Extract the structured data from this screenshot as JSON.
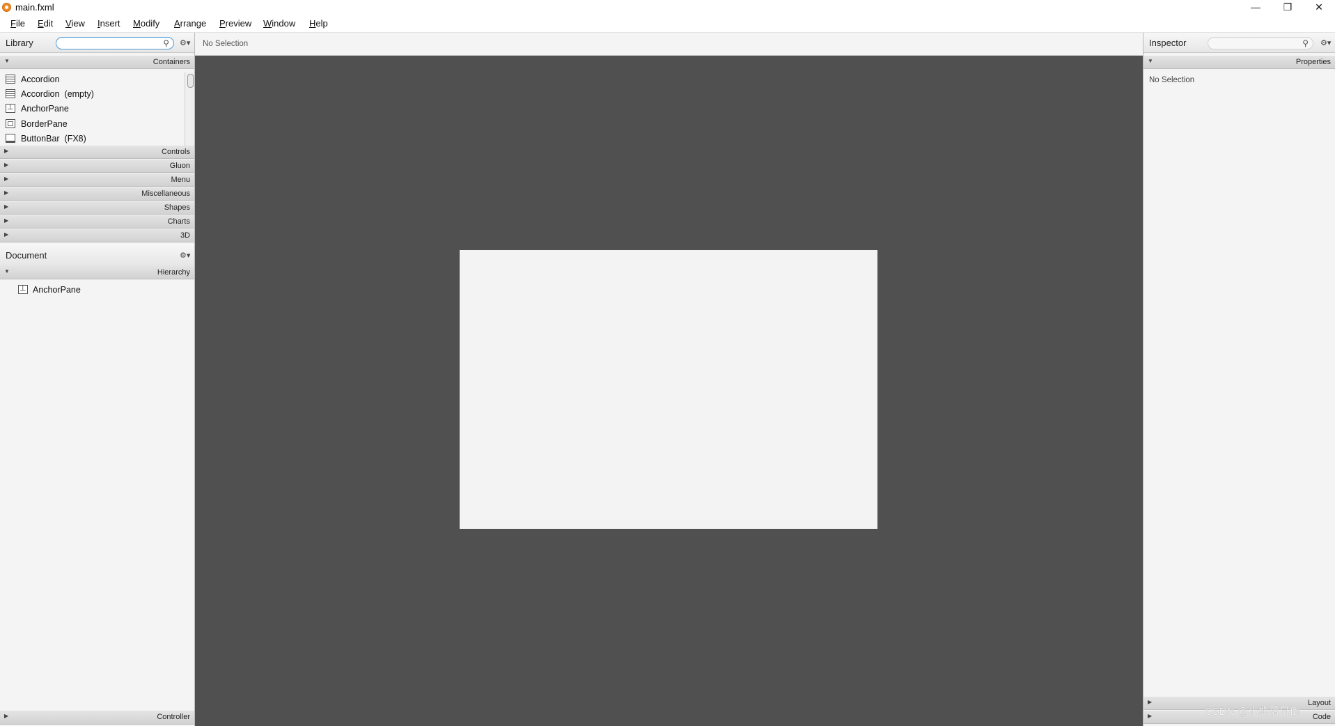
{
  "window": {
    "title": "main.fxml"
  },
  "menu": [
    "File",
    "Edit",
    "View",
    "Insert",
    "Modify",
    "Arrange",
    "Preview",
    "Window",
    "Help"
  ],
  "library": {
    "title": "Library",
    "search_placeholder": "",
    "open_section": "Containers",
    "items": [
      "Accordion",
      "Accordion  (empty)",
      "AnchorPane",
      "BorderPane",
      "ButtonBar  (FX8)"
    ],
    "sections": [
      "Controls",
      "Gluon",
      "Menu",
      "Miscellaneous",
      "Shapes",
      "Charts",
      "3D"
    ]
  },
  "document": {
    "title": "Document",
    "section": "Hierarchy",
    "hierarchy_items": [
      "AnchorPane"
    ],
    "bottom_section": "Controller"
  },
  "center": {
    "status": "No Selection"
  },
  "inspector": {
    "title": "Inspector",
    "search_placeholder": "",
    "section": "Properties",
    "no_selection": "No Selection",
    "bottom_sections": [
      "Layout",
      "Code"
    ]
  },
  "watermark": "CSDN @小熊落日倒",
  "colors": {
    "canvas": "#505050",
    "document": "#f3f3f3",
    "search_focus": "#4d9bd8",
    "app_icon": "#f08a24"
  },
  "icons": [
    "app-icon",
    "minimize-icon",
    "restore-icon",
    "close-icon",
    "search-icon",
    "gear-icon",
    "accordion-icon",
    "anchorpane-icon",
    "borderpane-icon",
    "buttonbar-icon"
  ]
}
